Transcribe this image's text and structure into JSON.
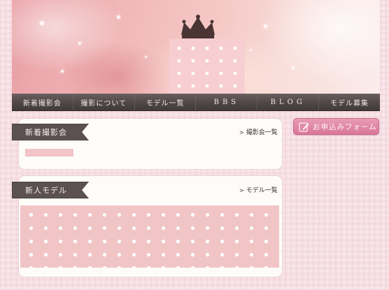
{
  "header": {
    "banner_name": "header-banner",
    "crown_icon": "crown-icon"
  },
  "nav": {
    "items": [
      {
        "label": "新着撮影会"
      },
      {
        "label": "撮影について"
      },
      {
        "label": "モデル一覧"
      },
      {
        "label": "BBS"
      },
      {
        "label": "BLOG"
      },
      {
        "label": "モデル募集"
      }
    ]
  },
  "sections": {
    "new_shoots": {
      "title": "新着撮影会",
      "link_label": "撮影会一覧"
    },
    "new_models": {
      "title": "新人モデル",
      "link_label": "モデル一覧"
    }
  },
  "sidebar": {
    "apply_label": "お申込みフォーム",
    "apply_icon": "pencil-note-icon"
  },
  "colors": {
    "page_bg": "#f6dfe4",
    "nav_bg": "#4d4444",
    "ribbon_bg": "#5b5151",
    "apply_button": "#d9769a",
    "lace_pink": "#f1c5c6"
  }
}
